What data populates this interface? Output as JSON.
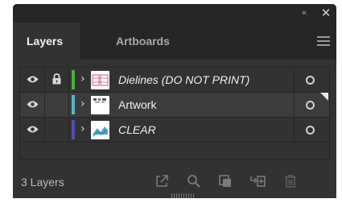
{
  "panel": {
    "collapse_icon": "double-chevron-left-icon",
    "close_icon": "close-icon",
    "collapse_glyph": "«",
    "close_glyph": "✕"
  },
  "tabs": [
    {
      "label": "Layers",
      "active": true
    },
    {
      "label": "Artboards",
      "active": false
    }
  ],
  "menu_icon": "hamburger-menu-icon",
  "layers": [
    {
      "name": "Dielines (DO NOT PRINT)",
      "italic": true,
      "visible": true,
      "locked": true,
      "color": "#4caf3e",
      "thumb": "dielines-thumb",
      "selected": false
    },
    {
      "name": "Artwork",
      "italic": false,
      "visible": true,
      "locked": false,
      "color": "#55b6cc",
      "thumb": "artwork-thumb",
      "selected": true
    },
    {
      "name": "CLEAR",
      "italic": true,
      "visible": true,
      "locked": false,
      "color": "#4f4fb0",
      "thumb": "clear-thumb",
      "selected": false
    }
  ],
  "footer": {
    "layer_count": "3 Layers",
    "icons": [
      "export-icon",
      "search-icon",
      "make-clipping-mask-icon",
      "new-sublayer-icon",
      "trash-icon"
    ]
  }
}
